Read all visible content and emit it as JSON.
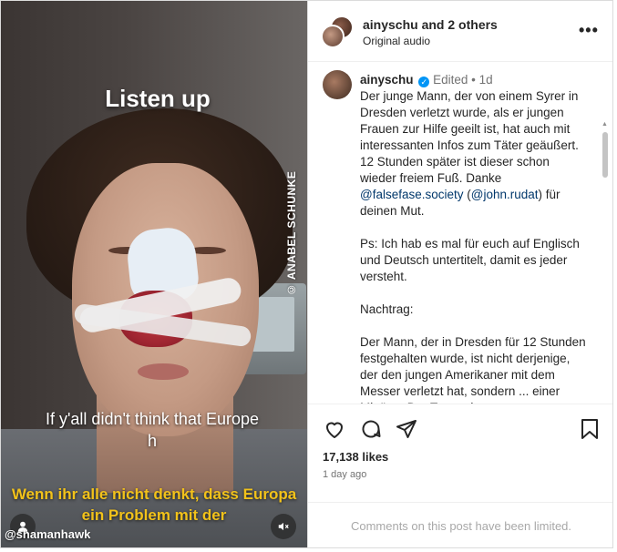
{
  "video": {
    "overlay_title": "Listen up",
    "watermark": "© ANABEL SCHUNKE",
    "subtitle_en_line1": "If y'all didn't think that Europe",
    "subtitle_en_line2": "h",
    "subtitle_de": "Wenn ihr alle nicht denkt, dass Europa ein Problem mit der",
    "handle": "@shamanhawk"
  },
  "header": {
    "username": "ainyschu",
    "and_others": "and 2 others",
    "audio": "Original audio",
    "more": "•••"
  },
  "caption": {
    "username": "ainyschu",
    "verified_mark": "✓",
    "edited": "Edited",
    "separator": "•",
    "age": "1d",
    "p1_a": "Der junge Mann, der von einem Syrer in Dresden verletzt wurde, als er jungen Frauen zur Hilfe geeilt ist, hat auch mit interessanten Infos zum Täter geäußert. 12 Stunden später ist dieser schon wieder freiem Fuß. Danke ",
    "link1": "@falsefase.society",
    "p1_b": " (",
    "link2": "@john.rudat",
    "p1_c": ") für deinen Mut.",
    "p2": "Ps: Ich hab es mal für euch auf Englisch und Deutsch untertitelt, damit es jeder versteht.",
    "p3": "Nachtrag:",
    "p4": "Der Mann, der in Dresden für 12 Stunden festgehalten wurde, ist nicht derjenige, der den jungen Amerikaner mit dem Messer verletzt hat, sondern ... einer Mittäter. Der Taugenbaum"
  },
  "actions": {
    "likes": "17,138 likes",
    "ago": "1 day ago"
  },
  "footer": {
    "comments_limited": "Comments on this post have been limited."
  },
  "icons": [
    "heart-icon",
    "comment-icon",
    "share-icon",
    "bookmark-icon",
    "user-tag-icon",
    "mute-icon",
    "more-options-icon",
    "verified-badge-icon"
  ],
  "colors": {
    "subtitle_yellow": "#f2c21a",
    "verified_blue": "#0095f6",
    "link": "#00376b",
    "muted_text": "#737373"
  }
}
